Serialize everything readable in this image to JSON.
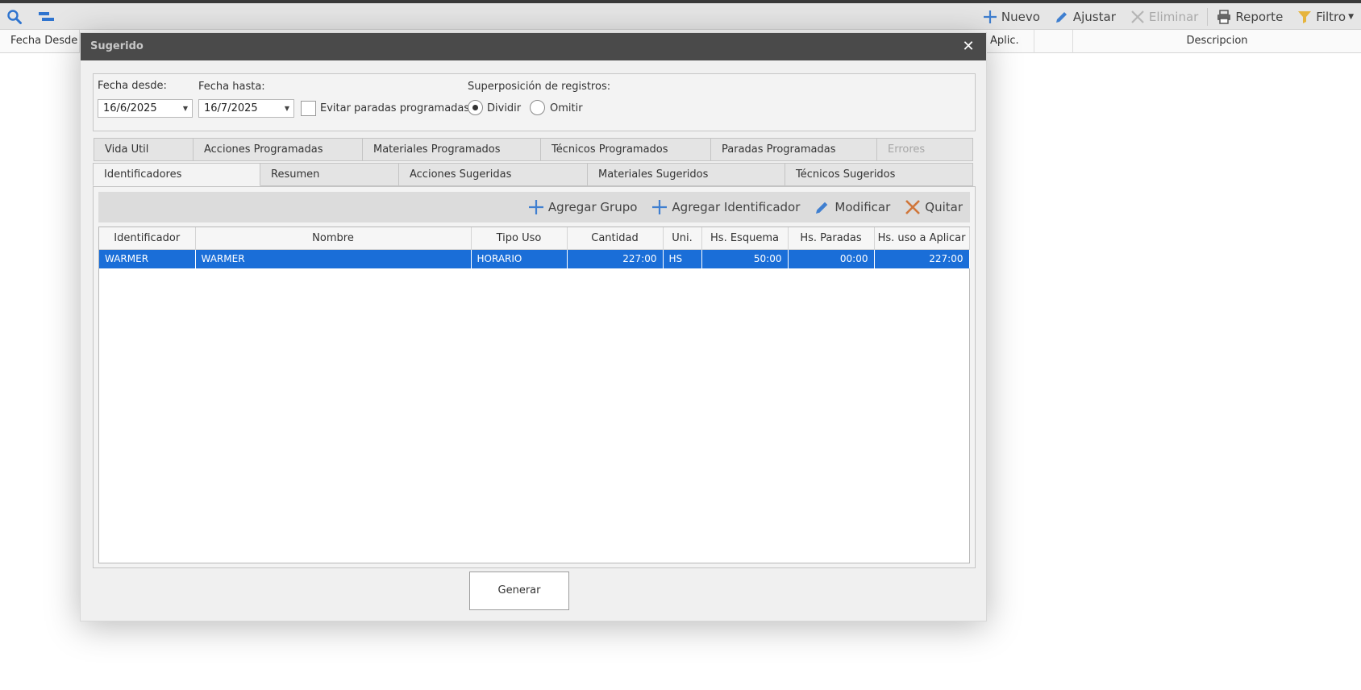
{
  "toolbar": {
    "left_icons": [
      "search-icon",
      "gantt-icon"
    ],
    "buttons": {
      "nuevo": "Nuevo",
      "ajustar": "Ajustar",
      "eliminar": "Eliminar",
      "reporte": "Reporte",
      "filtro": "Filtro"
    }
  },
  "grid_header": {
    "fecha_desde": "Fecha Desde",
    "aplic": "Aplic.",
    "descripcion": "Descripcion"
  },
  "dialog": {
    "title": "Sugerido",
    "close": "✕",
    "filters": {
      "fecha_desde_label": "Fecha desde:",
      "fecha_desde_value": "16/6/2025",
      "fecha_hasta_label": "Fecha hasta:",
      "fecha_hasta_value": "16/7/2025",
      "evitar_label": "Evitar paradas programadas",
      "evitar_checked": false,
      "superposicion_label": "Superposición de registros:",
      "dividir_label": "Dividir",
      "omitir_label": "Omitir",
      "selected_option": "Dividir"
    },
    "tabs_row1": [
      "Vida Util",
      "Acciones Programadas",
      "Materiales Programados",
      "Técnicos Programados",
      "Paradas Programadas",
      "Errores"
    ],
    "tabs_row2": [
      "Identificadores",
      "Resumen",
      "Acciones Sugeridas",
      "Materiales Sugeridos",
      "Técnicos Sugeridos"
    ],
    "active_tab": "Identificadores",
    "inner_toolbar": {
      "agregar_grupo": "Agregar Grupo",
      "agregar_identificador": "Agregar Identificador",
      "modificar": "Modificar",
      "quitar": "Quitar"
    },
    "table": {
      "columns": [
        "Identificador",
        "Nombre",
        "Tipo Uso",
        "Cantidad",
        "Uni.",
        "Hs. Esquema",
        "Hs. Paradas",
        "Hs. uso a Aplicar"
      ],
      "rows": [
        [
          "WARMER",
          "WARMER",
          "HORARIO",
          "227:00",
          "HS",
          "50:00",
          "00:00",
          "227:00"
        ]
      ]
    },
    "generar_label": "Generar"
  },
  "colors": {
    "selection": "#1a6ed8",
    "title_bar": "#4a4a4a",
    "icon_blue": "#3f7fd0",
    "icon_orange": "#d0763a",
    "icon_filter": "#e6b43c"
  }
}
